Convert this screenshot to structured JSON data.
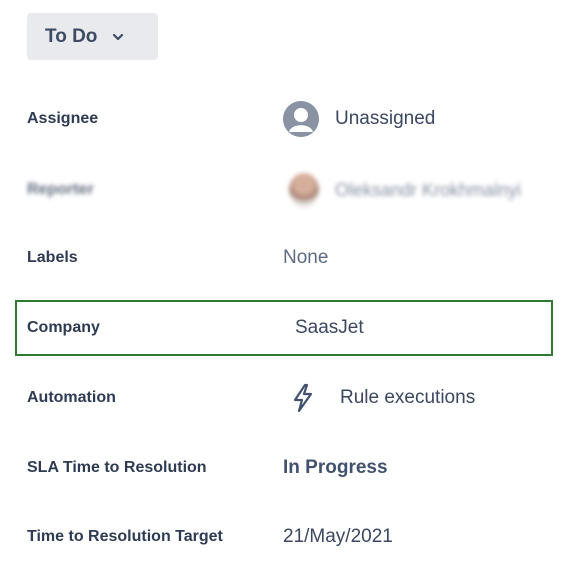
{
  "status": {
    "label": "To Do"
  },
  "fields": {
    "assignee": {
      "label": "Assignee",
      "value": "Unassigned",
      "icon": "user-avatar-icon"
    },
    "reporter": {
      "label": "Reporter",
      "value": "Oleksandr Krokhmalnyi",
      "icon": "reporter-avatar"
    },
    "labels": {
      "label": "Labels",
      "value": "None"
    },
    "company": {
      "label": "Company",
      "value": "SaasJet"
    },
    "automation": {
      "label": "Automation",
      "value": "Rule executions",
      "icon": "lightning-bolt-icon"
    },
    "sla": {
      "label": "SLA Time to Resolution",
      "value": "In Progress"
    },
    "target": {
      "label": "Time to Resolution Target",
      "value": "21/May/2021"
    }
  },
  "colors": {
    "highlight_border": "#2e7a2e",
    "status_bg": "#e9eaee",
    "text": "#3b4760"
  }
}
